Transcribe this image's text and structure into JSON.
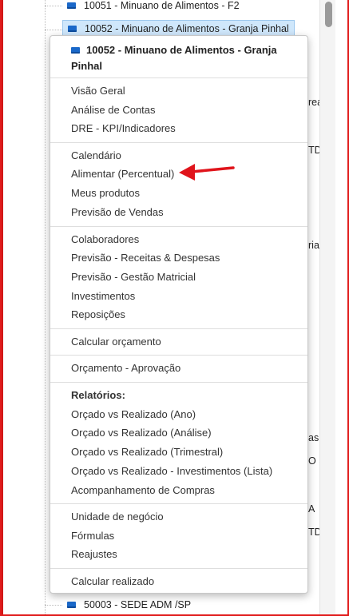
{
  "tree": {
    "nodes": [
      {
        "label": "10051 - Minuano de Alimentos - F2",
        "selected": false
      },
      {
        "label": "10052 - Minuano de Alimentos - Granja Pinhal",
        "selected": true
      },
      {
        "label": "50003 - SEDE ADM /SP",
        "selected": false
      }
    ],
    "peeks": [
      "rea",
      "TDA",
      "ria",
      "as A",
      "O S",
      "A",
      "TDA"
    ]
  },
  "context_menu": {
    "header_title": "10052 - Minuano de Alimentos - Granja Pinhal",
    "groups": [
      [
        "Visão Geral",
        "Análise de Contas",
        "DRE - KPI/Indicadores"
      ],
      [
        "Calendário",
        "Alimentar (Percentual)",
        "Meus produtos",
        "Previsão de Vendas"
      ],
      [
        "Colaboradores",
        "Previsão - Receitas & Despesas",
        "Previsão - Gestão Matricial",
        "Investimentos",
        "Reposições"
      ],
      [
        "Calcular orçamento"
      ],
      [
        "Orçamento - Aprovação"
      ],
      [
        "Orçado vs Realizado (Ano)",
        "Orçado vs Realizado (Análise)",
        "Orçado vs Realizado (Trimestral)",
        "Orçado vs Realizado - Investimentos (Lista)",
        "Acompanhamento de Compras"
      ],
      [
        "Unidade de negócio",
        "Fórmulas",
        "Reajustes"
      ],
      [
        "Calcular realizado"
      ]
    ],
    "reports_heading": "Relatórios:"
  },
  "annotation": {
    "color": "#e0141b",
    "points_to": "Alimentar (Percentual)"
  }
}
